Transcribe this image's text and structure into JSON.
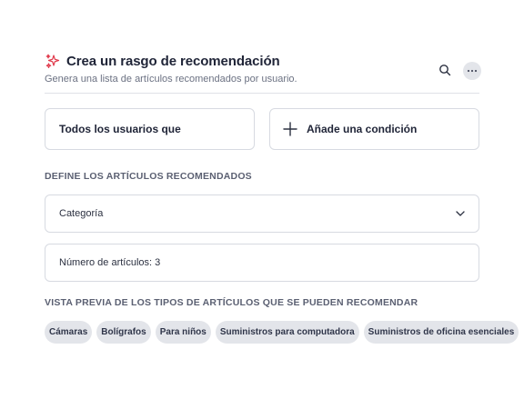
{
  "header": {
    "title": "Crea un rasgo de recomendación",
    "subtitle": "Genera una lista de artículos recomendados por usuario.",
    "accent_color": "#e0384a",
    "icons": {
      "title": "sparkle-icon",
      "search": "search-icon",
      "more": "more-horizontal-icon"
    }
  },
  "audience": {
    "users_label": "Todos los usuarios que",
    "add_condition_label": "Añade una condición",
    "add_condition_icon": "plus-icon"
  },
  "define_section": {
    "label": "DEFINE LOS ARTÍCULOS RECOMENDADOS",
    "category_select_value": "Categoría",
    "category_select_icon": "chevron-down-icon",
    "item_count_text": "Número de artículos: 3"
  },
  "preview_section": {
    "label": "VISTA PREVIA DE LOS TIPOS DE ARTÍCULOS QUE SE PUEDEN RECOMENDAR",
    "chips": [
      "Cámaras",
      "Bolígrafos",
      "Para niños",
      "Suministros para computadora",
      "Suministros de oficina esenciales"
    ]
  }
}
